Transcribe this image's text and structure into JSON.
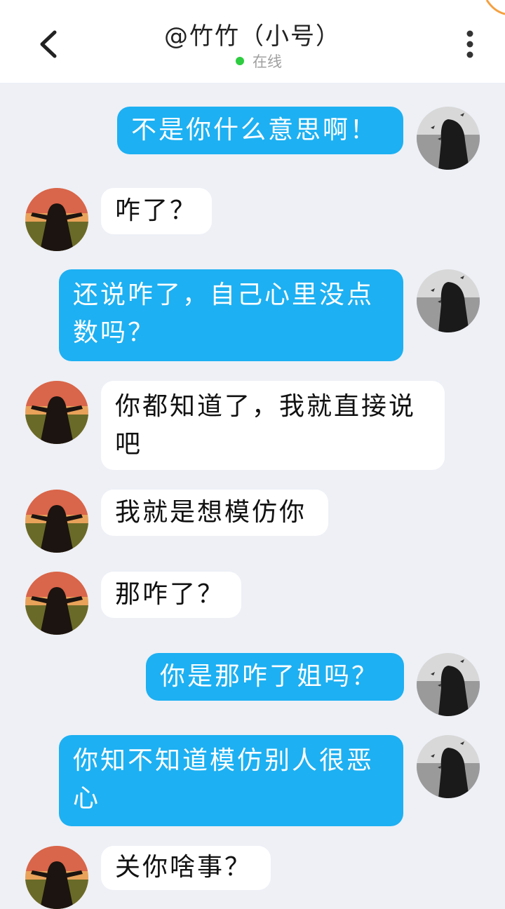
{
  "header": {
    "title": "@竹竹（小号）",
    "status_text": "在线",
    "status_color": "#2ecc40",
    "back_icon": "chevron-left-icon",
    "menu_icon": "more-vertical-icon"
  },
  "colors": {
    "outgoing_bubble": "#1db0f2",
    "incoming_bubble": "#ffffff",
    "background": "#eef0f6"
  },
  "messages": [
    {
      "side": "out",
      "text": "不是你什么意思啊！"
    },
    {
      "side": "in",
      "text": "咋了？"
    },
    {
      "side": "out",
      "text": "还说咋了，自己心里没点数吗？"
    },
    {
      "side": "in",
      "text": "你都知道了，我就直接说吧"
    },
    {
      "side": "in",
      "text": "我就是想模仿你"
    },
    {
      "side": "in",
      "text": "那咋了？"
    },
    {
      "side": "out",
      "text": "你是那咋了姐吗？"
    },
    {
      "side": "out",
      "text": "你知不知道模仿别人很恶心"
    },
    {
      "side": "in",
      "text": "关你啥事？"
    }
  ]
}
